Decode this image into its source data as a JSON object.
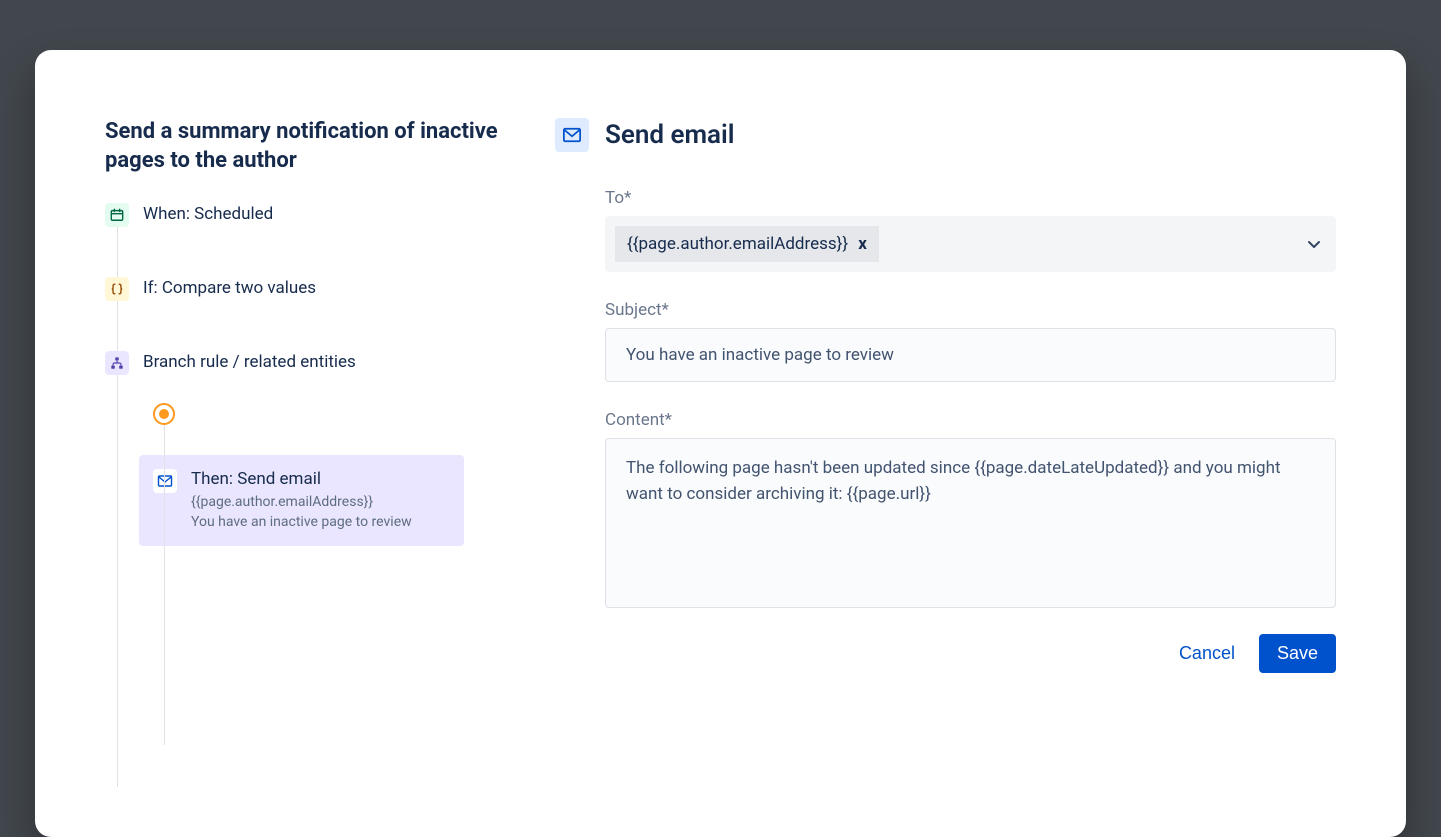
{
  "title": "Send a summary notification of inactive pages to the author",
  "steps": {
    "when": "When: Scheduled",
    "if": "If: Compare two values",
    "branch": "Branch rule / related entities"
  },
  "node": {
    "title": "Then: Send email",
    "recipient": "{{page.author.emailAddress}}",
    "subject_preview": "You have an inactive page to review"
  },
  "panel": {
    "heading": "Send email",
    "labels": {
      "to": "To*",
      "subject": "Subject*",
      "content": "Content*"
    },
    "to_chip": "{{page.author.emailAddress}}",
    "subject_value": "You have an inactive page to review",
    "content_value": "The following page hasn't been updated since {{page.dateLateUpdated}} and you might want to consider archiving it: {{page.url}}"
  },
  "buttons": {
    "cancel": "Cancel",
    "save": "Save"
  }
}
